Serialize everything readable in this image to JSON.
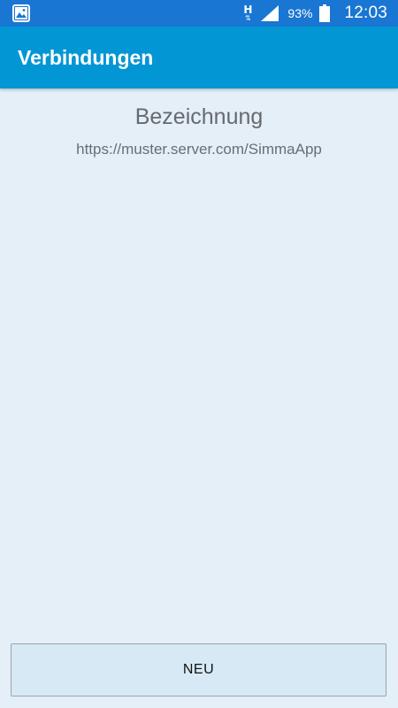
{
  "status_bar": {
    "network_type": "H",
    "network_arrows": "⇅",
    "battery_percent": "93%",
    "battery_level": 0.93,
    "time": "12:03",
    "icons": {
      "left": "gallery-notification-icon",
      "signal": "signal-strength-icon",
      "battery": "battery-icon"
    },
    "background_color": "#1976d2"
  },
  "app_bar": {
    "title": "Verbindungen",
    "background_color": "#0396d4"
  },
  "connections": [
    {
      "name": "Bezeichnung",
      "url": "https://muster.server.com/SimmaApp"
    }
  ],
  "actions": {
    "new_label": "NEU"
  },
  "colors": {
    "page_background": "#e4eff7",
    "button_background": "#d7e9f5"
  }
}
